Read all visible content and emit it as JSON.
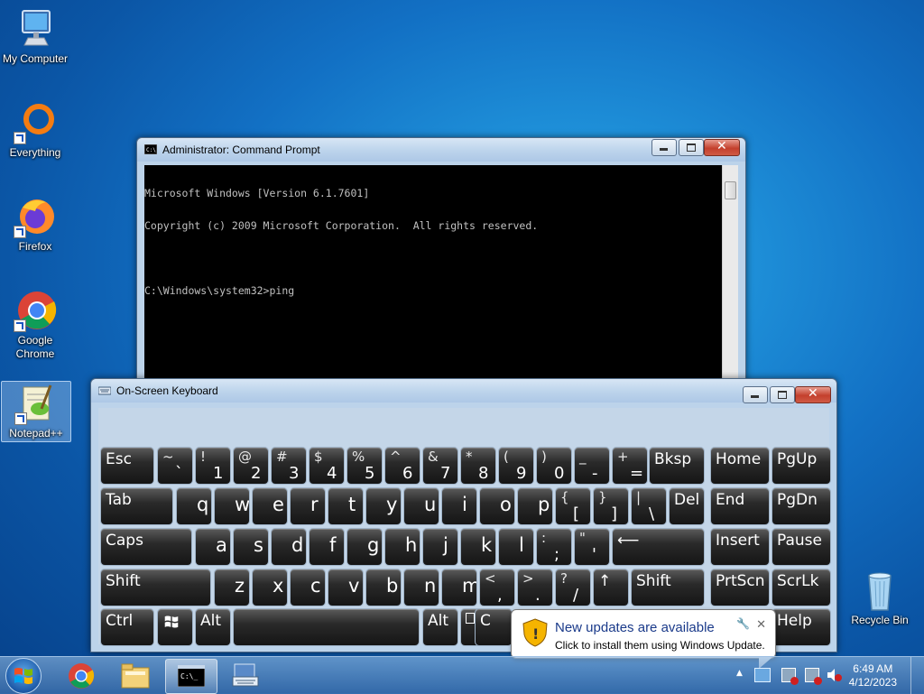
{
  "desktop": {
    "icons": [
      {
        "label": "My Computer",
        "icon": "computer-icon"
      },
      {
        "label": "Everything",
        "icon": "everything-icon"
      },
      {
        "label": "Firefox",
        "icon": "firefox-icon"
      },
      {
        "label": "Google Chrome",
        "icon": "chrome-icon"
      },
      {
        "label": "Notepad++",
        "icon": "notepadpp-icon"
      },
      {
        "label": "Recycle Bin",
        "icon": "recycle-bin-icon"
      }
    ]
  },
  "cmd_window": {
    "title": "Administrator:  Command Prompt",
    "lines": [
      "Microsoft Windows [Version 6.1.7601]",
      "Copyright (c) 2009 Microsoft Corporation.  All rights reserved.",
      "",
      "C:\\Windows\\system32>ping"
    ]
  },
  "osk_window": {
    "title": "On-Screen Keyboard",
    "keys": {
      "esc": "Esc",
      "tab": "Tab",
      "caps": "Caps",
      "shift_l": "Shift",
      "shift_r": "Shift",
      "ctrl": "Ctrl",
      "alt_l": "Alt",
      "alt_r": "Alt",
      "bksp": "Bksp",
      "del": "Del",
      "home": "Home",
      "pgup": "PgUp",
      "end": "End",
      "pgdn": "PgDn",
      "insert": "Insert",
      "pause": "Pause",
      "prtscn": "PrtScn",
      "scrlk": "ScrLk",
      "help": "Help",
      "c_partial": "C"
    },
    "number_row": [
      {
        "hi": "~",
        "lo": "`"
      },
      {
        "hi": "!",
        "lo": "1"
      },
      {
        "hi": "@",
        "lo": "2"
      },
      {
        "hi": "#",
        "lo": "3"
      },
      {
        "hi": "$",
        "lo": "4"
      },
      {
        "hi": "%",
        "lo": "5"
      },
      {
        "hi": "^",
        "lo": "6"
      },
      {
        "hi": "&",
        "lo": "7"
      },
      {
        "hi": "*",
        "lo": "8"
      },
      {
        "hi": "(",
        "lo": "9"
      },
      {
        "hi": ")",
        "lo": "0"
      },
      {
        "hi": "_",
        "lo": "-"
      },
      {
        "hi": "+",
        "lo": "="
      }
    ],
    "row_q": [
      "q",
      "w",
      "e",
      "r",
      "t",
      "y",
      "u",
      "i",
      "o",
      "p"
    ],
    "row_q_sym": [
      {
        "hi": "{",
        "lo": "["
      },
      {
        "hi": "}",
        "lo": "]"
      },
      {
        "hi": "|",
        "lo": "\\"
      }
    ],
    "row_a": [
      "a",
      "s",
      "d",
      "f",
      "g",
      "h",
      "j",
      "k",
      "l"
    ],
    "row_a_sym": [
      {
        "hi": ":",
        "lo": ";"
      },
      {
        "hi": "\"",
        "lo": "'"
      }
    ],
    "row_z": [
      "z",
      "x",
      "c",
      "v",
      "b",
      "n",
      "m"
    ],
    "row_z_sym": [
      {
        "hi": "<",
        "lo": ","
      },
      {
        "hi": ">",
        "lo": "."
      },
      {
        "hi": "?",
        "lo": "/"
      }
    ],
    "up_arrow": "↑",
    "enter_arrow": "⟵"
  },
  "notification": {
    "title": "New updates are available",
    "body": "Click to install them using Windows Update."
  },
  "taskbar": {
    "time": "6:49 AM",
    "date": "4/12/2023",
    "tray_arrow": "▲"
  }
}
